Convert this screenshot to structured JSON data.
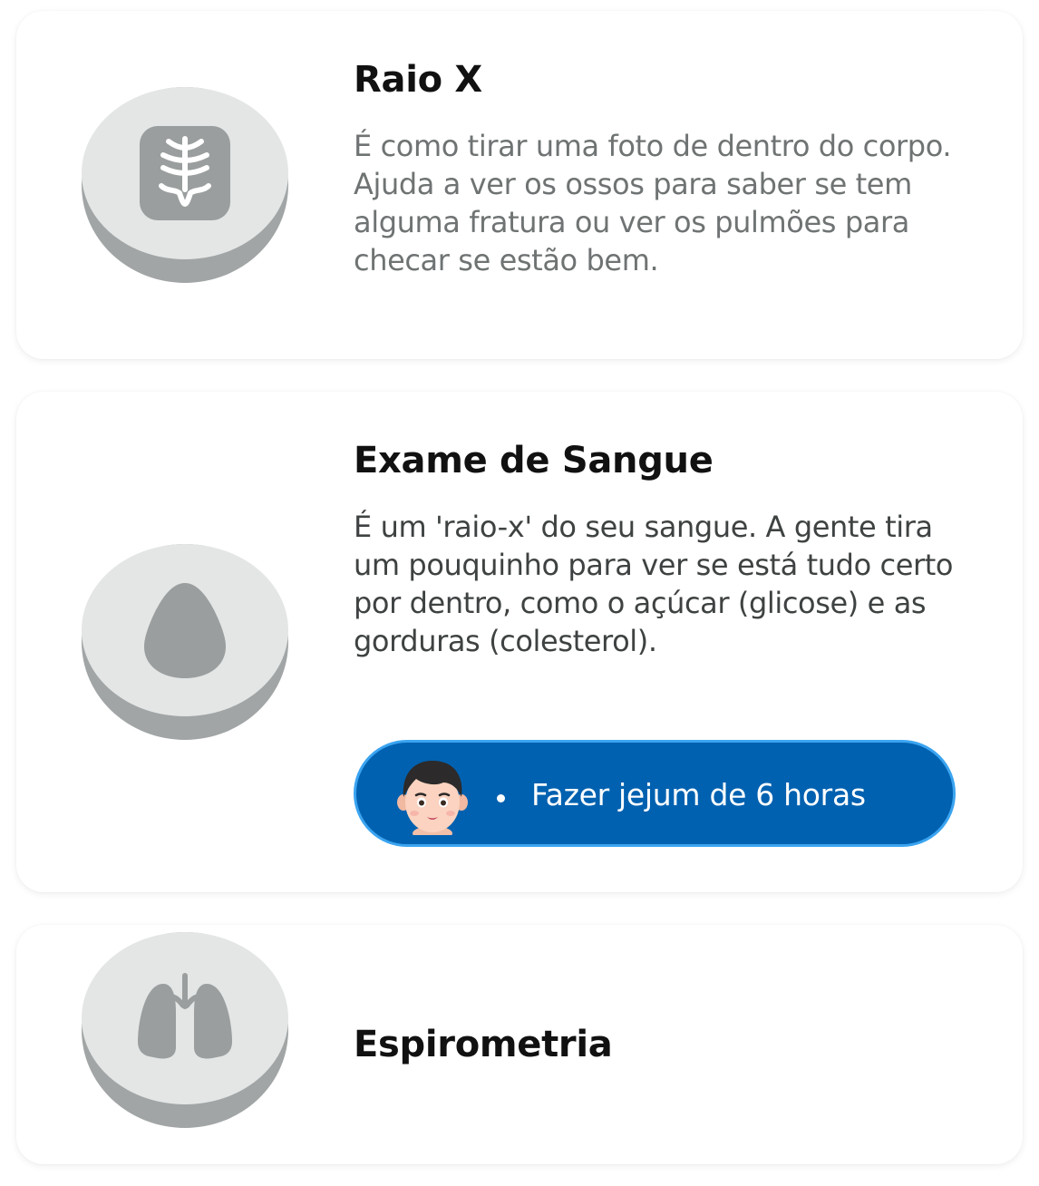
{
  "exams": [
    {
      "title": "Raio X",
      "description": "É como tirar uma foto de dentro do corpo. Ajuda a ver os ossos para saber se tem alguma fratura ou ver os pulmões para checar se estão bem.",
      "icon": "xray-spine-icon"
    },
    {
      "title": "Exame de Sangue",
      "description": "É um 'raio-x' do seu sangue. A gente tira um pouquinho para ver se está tudo certo por dentro, como o açúcar (glicose) e as gorduras (colesterol).",
      "icon": "blood-drop-icon",
      "tip": {
        "text": "Fazer jejum de 6 horas",
        "avatar": "person-avatar"
      }
    },
    {
      "title": "Espirometria",
      "icon": "lungs-icon"
    }
  ],
  "colors": {
    "disc_face": "#e4e6e6",
    "disc_base": "#a1a5a5",
    "icon_gray": "#9a9e9e",
    "tip_background": "#0061b0",
    "tip_border": "#3ba4f0",
    "title_text": "#111111",
    "muted_text": "#6f7373"
  }
}
